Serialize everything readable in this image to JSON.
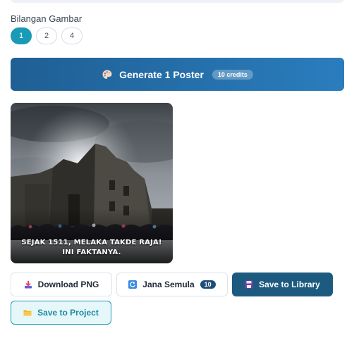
{
  "image_count": {
    "label": "Bilangan Gambar",
    "options": [
      "1",
      "2",
      "4"
    ],
    "selected": "1"
  },
  "generate": {
    "icon": "palette-icon",
    "label": "Generate 1 Poster",
    "credits": "10 credits"
  },
  "poster": {
    "caption_line1": "SEJAK 1511, MELAKA TAKDE RAJA!",
    "caption_line2": "INI FAKTANYA."
  },
  "actions": {
    "download_label": "Download PNG",
    "regenerate_label": "Jana Semula",
    "regenerate_cost": "10",
    "library_label": "Save to Library",
    "project_label": "Save to Project"
  },
  "colors": {
    "accent": "#1a9bb5",
    "generate_start": "#1f5f94",
    "generate_end": "#2a7dbd",
    "library_bg": "#1d5a80"
  }
}
